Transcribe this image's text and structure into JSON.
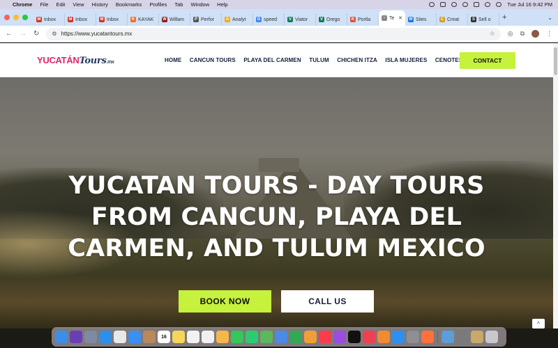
{
  "menubar": {
    "app": "Chrome",
    "items": [
      "File",
      "Edit",
      "View",
      "History",
      "Bookmarks",
      "Profiles",
      "Tab",
      "Window",
      "Help"
    ],
    "clock": "Tue Jul 16  9:42 PM"
  },
  "tabs": [
    {
      "label": "Inbox",
      "color": "#d93025",
      "glyph": "M"
    },
    {
      "label": "Inbox",
      "color": "#d93025",
      "glyph": "M"
    },
    {
      "label": "Inbox",
      "color": "#d93025",
      "glyph": "M"
    },
    {
      "label": "KAYAK",
      "color": "#ff690f",
      "glyph": "K"
    },
    {
      "label": "Willam",
      "color": "#8b1a1a",
      "glyph": "W"
    },
    {
      "label": "Perfor",
      "color": "#555555",
      "glyph": "P"
    },
    {
      "label": "Analyt",
      "color": "#f9ab00",
      "glyph": "A"
    },
    {
      "label": "speed",
      "color": "#4285f4",
      "glyph": "G"
    },
    {
      "label": "Viator",
      "color": "#1a7a5a",
      "glyph": "V"
    },
    {
      "label": "Orego",
      "color": "#1a7a5a",
      "glyph": "V"
    },
    {
      "label": "Portla",
      "color": "#e0503a",
      "glyph": "K"
    },
    {
      "label": "Te",
      "color": "#888888",
      "glyph": "-",
      "active": true
    },
    {
      "label": "Sites",
      "color": "#1a73e8",
      "glyph": "W"
    },
    {
      "label": "Creat",
      "color": "#d0a020",
      "glyph": "C"
    },
    {
      "label": "Sell o",
      "color": "#333333",
      "glyph": "S"
    }
  ],
  "address": {
    "url": "https://www.yucatantours.mx"
  },
  "site": {
    "logo_part1": "YUCATÁN",
    "logo_part2": "Tours",
    "logo_part3": ".mx",
    "nav": [
      "HOME",
      "CANCUN TOURS",
      "PLAYA DEL CARMEN",
      "TULUM",
      "CHICHEN ITZA",
      "ISLA MUJERES",
      "CENOTES"
    ],
    "contact_label": "CONTACT"
  },
  "hero": {
    "title_line1": "YUCATAN TOURS - DAY TOURS",
    "title_line2": "FROM CANCUN, PLAYA DEL",
    "title_line3": "CARMEN, AND TULUM MEXICO",
    "book_label": "BOOK NOW",
    "call_label": "CALL US",
    "back_to_top": "^"
  },
  "dock": {
    "calendar_day": "16",
    "icons": [
      {
        "name": "finder-icon",
        "color": "#3b8fe8"
      },
      {
        "name": "siri-icon",
        "color": "#6a3fb5"
      },
      {
        "name": "launchpad-icon",
        "color": "#7d8aa0"
      },
      {
        "name": "safari-icon",
        "color": "#2d8fe8"
      },
      {
        "name": "chrome-icon",
        "color": "#e8e8e8"
      },
      {
        "name": "mail-icon",
        "color": "#3a8ff0"
      },
      {
        "name": "contacts-icon",
        "color": "#b88a5a"
      },
      {
        "name": "calendar-icon",
        "color": "#ffffff"
      },
      {
        "name": "notes-icon",
        "color": "#f6d65a"
      },
      {
        "name": "reminders-icon",
        "color": "#f2f2f2"
      },
      {
        "name": "freeform-icon",
        "color": "#f0f0f0"
      },
      {
        "name": "photos-icon",
        "color": "#f5b74a"
      },
      {
        "name": "messages-icon",
        "color": "#34c759"
      },
      {
        "name": "facetime-icon",
        "color": "#2ecc71"
      },
      {
        "name": "maps-icon",
        "color": "#5bb85b"
      },
      {
        "name": "keynote-icon",
        "color": "#4a8ae8"
      },
      {
        "name": "numbers-icon",
        "color": "#34a853"
      },
      {
        "name": "pages-icon",
        "color": "#f29e38"
      },
      {
        "name": "music-icon",
        "color": "#fa3c4c"
      },
      {
        "name": "podcasts-icon",
        "color": "#9b4de0"
      },
      {
        "name": "appletv-icon",
        "color": "#111111"
      },
      {
        "name": "news-icon",
        "color": "#f04050"
      },
      {
        "name": "books-icon",
        "color": "#f28a30"
      },
      {
        "name": "appstore-icon",
        "color": "#2d8ff0"
      },
      {
        "name": "settings-icon",
        "color": "#8e8e93"
      },
      {
        "name": "firefox-icon",
        "color": "#ff7139"
      },
      {
        "name": "preview-icon",
        "color": "#5a9fd8"
      },
      {
        "name": "screenshot-icon",
        "color": "#7a7a7a"
      },
      {
        "name": "folder-icon",
        "color": "#c9a86a"
      },
      {
        "name": "trash-icon",
        "color": "#c8c8cc"
      }
    ]
  }
}
